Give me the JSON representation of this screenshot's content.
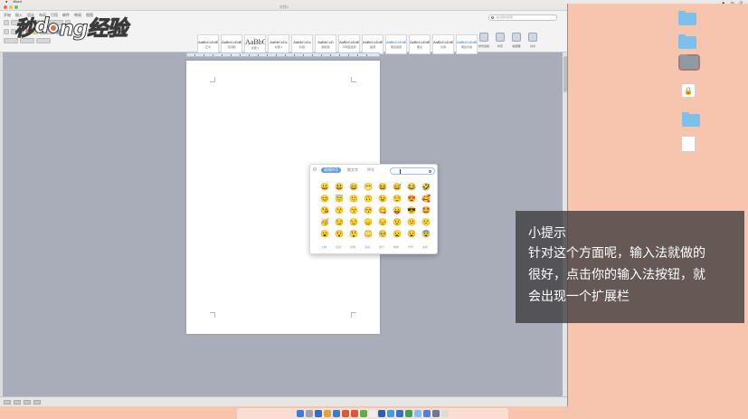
{
  "menubar": {
    "app_name": "Word"
  },
  "window": {
    "title": "文档1"
  },
  "ribbon": {
    "tabs": [
      "开始",
      "插入",
      "设计",
      "布局",
      "引用",
      "邮件",
      "审阅",
      "视图"
    ],
    "styles": [
      {
        "preview": "AaBbCcDdEe",
        "name": "正文",
        "variant": "normal"
      },
      {
        "preview": "AaBbCcDdEe",
        "name": "无间隔",
        "variant": "normal"
      },
      {
        "preview": "AaBbC",
        "name": "标题 1",
        "variant": "big"
      },
      {
        "preview": "AaBbCcDc",
        "name": "标题 2",
        "variant": "normal"
      },
      {
        "preview": "AaBbCcDc",
        "name": "标题",
        "variant": "normal"
      },
      {
        "preview": "AaBbCcD",
        "name": "副标题",
        "variant": "normal"
      },
      {
        "preview": "AaBbCcDdEe",
        "name": "不明显强调",
        "variant": "normal"
      },
      {
        "preview": "AaBbCcDdEe",
        "name": "强调",
        "variant": "normal"
      },
      {
        "preview": "AaBbCcDdEe",
        "name": "明显强调",
        "variant": "blue"
      },
      {
        "preview": "AaBbCcDdEe",
        "name": "要点",
        "variant": "normal"
      },
      {
        "preview": "AaBbCcDdEe",
        "name": "引用",
        "variant": "normal"
      },
      {
        "preview": "AaBbCcDdEe",
        "name": "明显引用",
        "variant": "blue"
      }
    ],
    "right_tools": [
      "样式窗格",
      "听写",
      "编辑器",
      "共享"
    ],
    "search_placeholder": "在文档中搜索"
  },
  "emoji_panel": {
    "tabs": [
      {
        "label": "表情符号",
        "active": true
      },
      {
        "label": "颜文字",
        "active": false
      },
      {
        "label": "符号",
        "active": false
      }
    ],
    "emojis": [
      "😀",
      "😃",
      "😄",
      "😁",
      "😆",
      "😅",
      "😂",
      "🤣",
      "😊",
      "😇",
      "🙂",
      "🙃",
      "😉",
      "😌",
      "😍",
      "🥰",
      "😘",
      "😗",
      "😙",
      "😚",
      "😋",
      "😛",
      "😎",
      "🤩",
      "🥳",
      "😏",
      "😒",
      "😞",
      "😔",
      "😟",
      "😕",
      "🙁",
      "😮",
      "😯",
      "😲",
      "😳",
      "🥺",
      "😦",
      "😧",
      "😨"
    ],
    "categories": [
      {
        "label": "人物",
        "active": true
      },
      {
        "label": "自然",
        "active": false
      },
      {
        "label": "食物",
        "active": false
      },
      {
        "label": "活动",
        "active": false
      },
      {
        "label": "旅行",
        "active": false
      },
      {
        "label": "物体",
        "active": false
      },
      {
        "label": "符号",
        "active": false
      },
      {
        "label": "旗帜",
        "active": false
      }
    ]
  },
  "tip": {
    "title": "小提示",
    "lines": [
      "针对这个方面呢，输入法就做的",
      "很好，点击你的输入法按钮，就",
      "会出现一个扩展栏"
    ]
  },
  "logo": {
    "text_before": "秒",
    "text_mid": "d",
    "text_after": "ng经验"
  },
  "colors": {
    "desktop": "#f7c4ad",
    "accent": "#5c9ee8",
    "folder": "#7ec0ec"
  }
}
